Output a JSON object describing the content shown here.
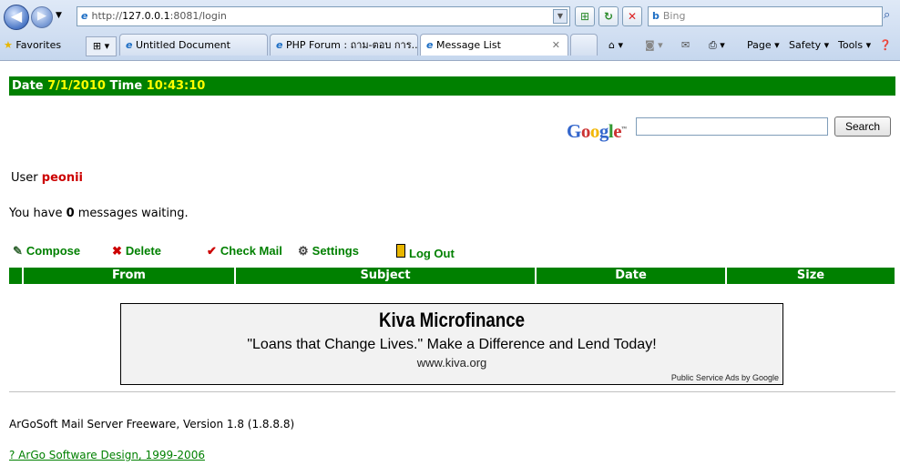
{
  "browser": {
    "address_prefix": "http://",
    "address_host": "127.0.0.1",
    "address_rest": ":8081/login",
    "search_placeholder": "Bing",
    "favorites_label": "Favorites",
    "tabs": [
      "Untitled Document",
      "PHP Forum : ถาม-ตอบ การ...",
      "Message List"
    ],
    "toolbar": {
      "page": "Page ▾",
      "safety": "Safety ▾",
      "tools": "Tools ▾"
    }
  },
  "page": {
    "date_label": "Date",
    "date_value": "7/1/2010",
    "time_label": "Time",
    "time_value": "10:43:10",
    "google_search_button": "Search",
    "user_label": "User",
    "user_name": "peonii",
    "messages_prefix": "You have",
    "messages_count": "0",
    "messages_suffix": "messages waiting.",
    "actions": {
      "compose": "Compose",
      "delete": "Delete",
      "check_mail": "Check Mail",
      "settings": "Settings",
      "logout": "Log Out"
    },
    "table_headers": [
      "From",
      "Subject",
      "Date",
      "Size"
    ],
    "ad": {
      "title": "Kiva Microfinance",
      "line": "\"Loans that Change Lives.\" Make a Difference and Lend Today!",
      "url": "www.kiva.org",
      "credit": "Public Service Ads by Google"
    },
    "footer_text": "ArGoSoft Mail Server Freeware, Version 1.8 (1.8.8.8)",
    "footer_link": "? ArGo Software Design, 1999-2006"
  },
  "colors": {
    "accent_green": "#008000",
    "highlight_yellow": "#ffff00",
    "user_red": "#cc0000"
  }
}
